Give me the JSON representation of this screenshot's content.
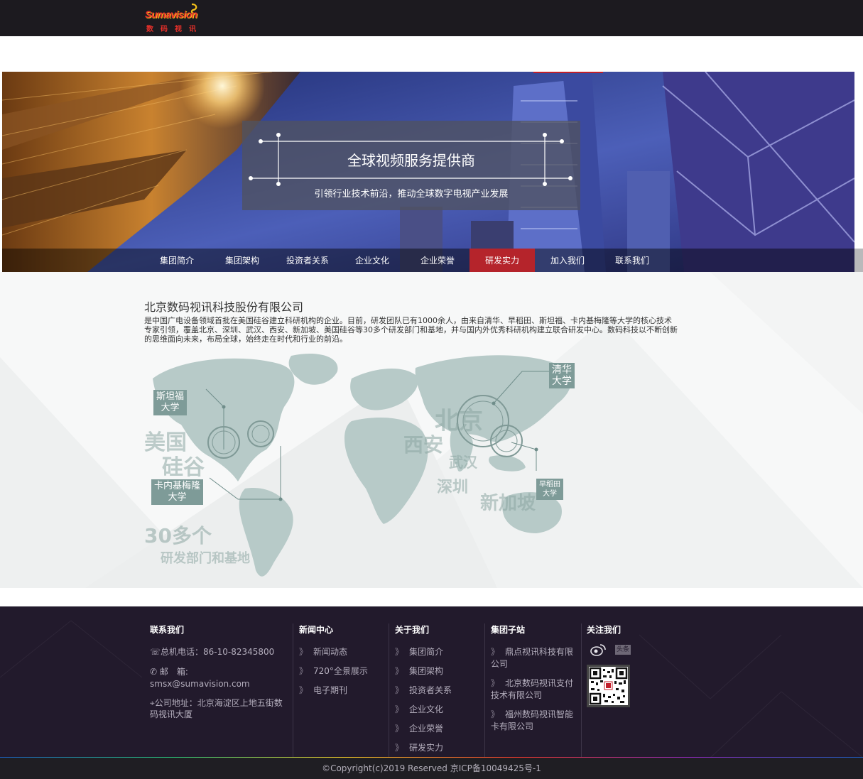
{
  "header": {
    "logo_en": "Sumavision",
    "logo_cn": "数码视讯"
  },
  "banner": {
    "title": "全球视频服务提供商",
    "subtitle": "引领行业技术前沿，推动全球数字电视产业发展"
  },
  "nav": {
    "items": [
      {
        "label": "集团简介"
      },
      {
        "label": "集团架构"
      },
      {
        "label": "投资者关系"
      },
      {
        "label": "企业文化"
      },
      {
        "label": "企业荣誉"
      },
      {
        "label": "研发实力"
      },
      {
        "label": "加入我们"
      },
      {
        "label": "联系我们"
      }
    ],
    "active_index": 5
  },
  "content": {
    "company_name": "北京数码视讯科技股份有限公司",
    "description": "是中国广电设备领域首批在美国硅谷建立科研机构的企业。目前，研发团队已有1000余人，由来自清华、早稻田、斯坦福、卡内基梅隆等大学的核心技术专家引领，覆盖北京、深圳、武汉、西安、新加坡、美国硅谷等30多个研发部门和基地，并与国内外优秀科研机构建立联合研发中心。数码科技以不断创新的思维面向未来，布局全球，始终走在时代和行业的前沿。",
    "map": {
      "tags": {
        "qinghua": "清华\n大学",
        "stanford": "斯坦福\n大学",
        "cmu": "卡内基梅隆\n大学",
        "waseda": "早稻田\n大学"
      },
      "labels": {
        "us": "美国",
        "silicon_valley": "硅谷",
        "beijing": "北京",
        "xian": "西安",
        "wuhan": "武汉",
        "shenzhen": "深圳",
        "singapore": "新加坡",
        "count": "30多个",
        "count_sub": "研发部门和基地"
      }
    }
  },
  "footer": {
    "contact": {
      "heading": "联系我们",
      "phone": "总机电话：86-10-82345800",
      "email_label": "邮　箱:",
      "email": "smsx@sumavision.com",
      "address": "公司地址：北京海淀区上地五街数码视讯大厦"
    },
    "news": {
      "heading": "新闻中心",
      "items": [
        "新闻动态",
        "720°全景展示",
        "电子期刊"
      ]
    },
    "about": {
      "heading": "关于我们",
      "items": [
        "集团简介",
        "集团架构",
        "投资者关系",
        "企业文化",
        "企业荣誉",
        "研发实力"
      ]
    },
    "subsites": {
      "heading": "集团子站",
      "items": [
        "鼎点视讯科技有限公司",
        "北京数码视讯支付技术有限公司",
        "福州数码视讯智能卡有限公司"
      ]
    },
    "follow": {
      "heading": "关注我们",
      "toutiao": "头条"
    },
    "chevron": "》",
    "copyright": "©Copyright(c)2019 Reserved 京ICP备10049425号-1"
  },
  "colors": {
    "topbar": "#1c1a1f",
    "accent_red": "#b5242b",
    "footer_bg": "#221a2c",
    "map_tag": "#7e9b98"
  }
}
